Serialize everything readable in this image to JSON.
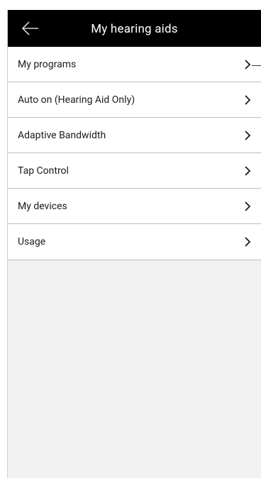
{
  "header": {
    "title": "My hearing aids",
    "back_icon": "arrow-left-icon"
  },
  "menu": {
    "items": [
      {
        "label": "My programs"
      },
      {
        "label": "Auto on (Hearing Aid Only)"
      },
      {
        "label": "Adaptive Bandwidth"
      },
      {
        "label": "Tap Control"
      },
      {
        "label": "My devices"
      },
      {
        "label": "Usage"
      }
    ],
    "chevron_icon": "chevron-right-icon"
  },
  "colors": {
    "header_bg": "#000000",
    "header_text": "#ffffff",
    "screen_bg": "#f1f1f1",
    "row_bg": "#ffffff",
    "divider": "#bdbdbd"
  }
}
